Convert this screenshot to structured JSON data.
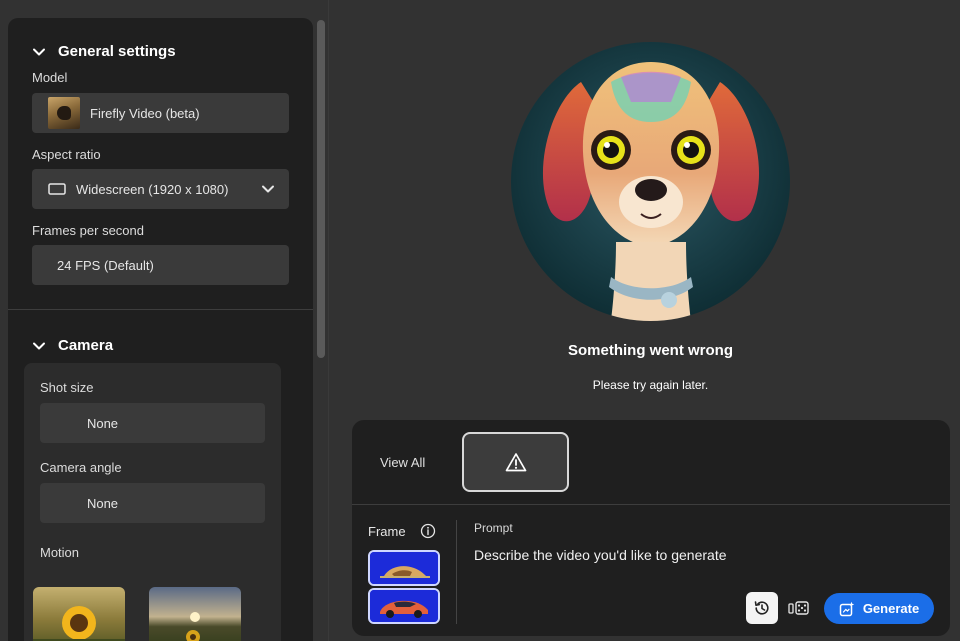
{
  "general_settings": {
    "title": "General settings",
    "model_label": "Model",
    "model_value": "Firefly Video (beta)",
    "aspect_label": "Aspect ratio",
    "aspect_value": "Widescreen (1920 x 1080)",
    "fps_label": "Frames per second",
    "fps_value": "24 FPS (Default)"
  },
  "camera": {
    "title": "Camera",
    "shot_size_label": "Shot size",
    "shot_size_value": "None",
    "angle_label": "Camera angle",
    "angle_value": "None",
    "motion_label": "Motion"
  },
  "error": {
    "title": "Something went wrong",
    "subtitle": "Please try again later."
  },
  "generator": {
    "view_all": "View All",
    "frame_label": "Frame",
    "prompt_label": "Prompt",
    "prompt_placeholder": "Describe the video you'd like to generate",
    "generate_label": "Generate"
  },
  "colors": {
    "accent": "#1b6ee8",
    "panel": "#1f1f1f",
    "background": "#323232"
  }
}
